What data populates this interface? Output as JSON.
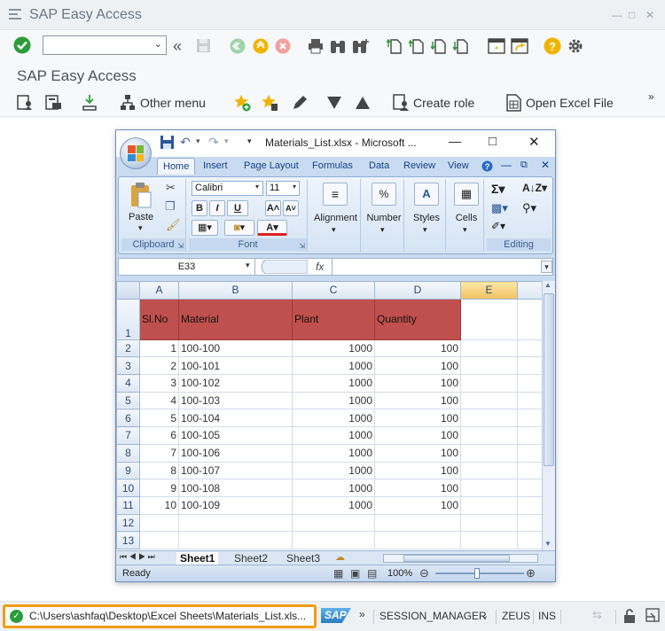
{
  "window": {
    "title": "SAP Easy Access"
  },
  "command_field": {
    "value": "",
    "placeholder": ""
  },
  "page": {
    "title": "SAP Easy Access"
  },
  "app_toolbar": {
    "other_menu": "Other menu",
    "create_role": "Create role",
    "open_excel": "Open Excel File",
    "more": "»"
  },
  "excel": {
    "title": "Materials_List.xlsx - Microsoft ...",
    "tabs": [
      "Home",
      "Insert",
      "Page Layout",
      "Formulas",
      "Data",
      "Review",
      "View"
    ],
    "groups": {
      "clipboard": "Clipboard",
      "paste": "Paste",
      "font": "Font",
      "font_name": "Calibri",
      "font_size": "11",
      "alignment": "Alignment",
      "number": "Number",
      "styles": "Styles",
      "cells": "Cells",
      "editing": "Editing"
    },
    "name_box": "E33",
    "fx": "fx",
    "columns": [
      "A",
      "B",
      "C",
      "D",
      "E"
    ],
    "headers": [
      "Sl.No",
      "Material",
      "Plant",
      "Quantity"
    ],
    "rows": [
      [
        "1",
        "100-100",
        "1000",
        "100"
      ],
      [
        "2",
        "100-101",
        "1000",
        "100"
      ],
      [
        "3",
        "100-102",
        "1000",
        "100"
      ],
      [
        "4",
        "100-103",
        "1000",
        "100"
      ],
      [
        "5",
        "100-104",
        "1000",
        "100"
      ],
      [
        "6",
        "100-105",
        "1000",
        "100"
      ],
      [
        "7",
        "100-106",
        "1000",
        "100"
      ],
      [
        "8",
        "100-107",
        "1000",
        "100"
      ],
      [
        "9",
        "100-108",
        "1000",
        "100"
      ],
      [
        "10",
        "100-109",
        "1000",
        "100"
      ]
    ],
    "row_numbers": [
      "1",
      "2",
      "3",
      "4",
      "5",
      "6",
      "7",
      "8",
      "9",
      "10",
      "11",
      "12",
      "13"
    ],
    "sheets": [
      "Sheet1",
      "Sheet2",
      "Sheet3"
    ],
    "status": "Ready",
    "zoom": "100%"
  },
  "status_bar": {
    "message": "C:\\Users\\ashfaq\\Desktop\\Excel Sheets\\Materials_List.xls...",
    "logo": "SAP",
    "more": "»",
    "session": "SESSION_MANAGER",
    "system": "ZEUS",
    "mode": "INS"
  },
  "colors": {
    "header_fill": "#c0504d",
    "highlight": "#f39c12",
    "ok_green": "#2a9d3a",
    "help_yellow": "#f0b400"
  }
}
